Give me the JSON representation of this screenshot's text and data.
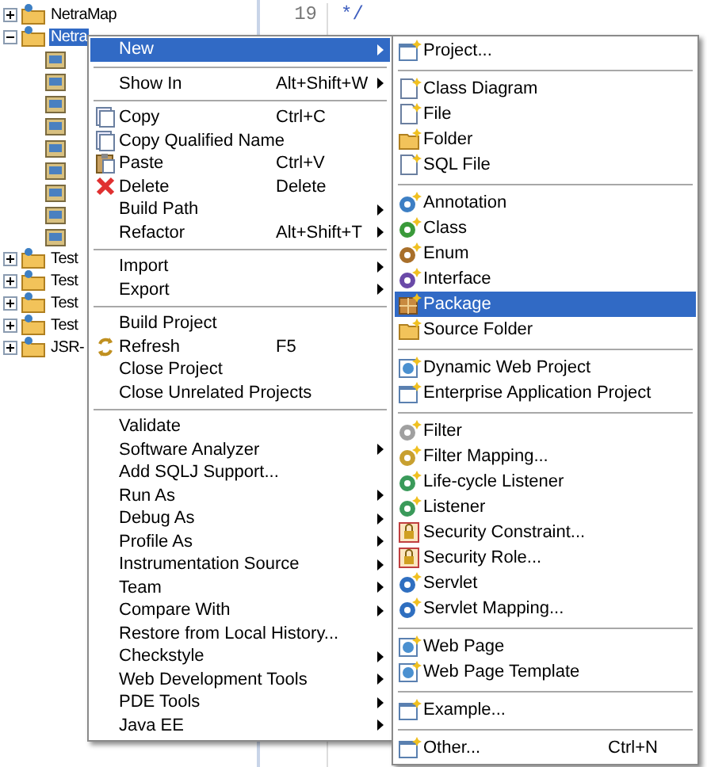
{
  "tree": {
    "items": [
      {
        "label": "NetraMap",
        "expanded": false,
        "selected": false
      },
      {
        "label": "Netra",
        "expanded": true,
        "selected": true
      },
      {
        "label": "Test",
        "expanded": false,
        "selected": false
      },
      {
        "label": "Test",
        "expanded": false,
        "selected": false
      },
      {
        "label": "Test",
        "expanded": false,
        "selected": false
      },
      {
        "label": "Test",
        "expanded": false,
        "selected": false
      },
      {
        "label": "JSR-",
        "expanded": false,
        "selected": false
      }
    ]
  },
  "editor": {
    "line_numbers": [
      "19"
    ],
    "code_lines": [
      "*/"
    ]
  },
  "context_menu": {
    "items": [
      {
        "kind": "item",
        "label": "New",
        "submenu": true,
        "selected": true
      },
      {
        "kind": "separator"
      },
      {
        "kind": "item",
        "label": "Show In",
        "shortcut": "Alt+Shift+W",
        "submenu": true,
        "selected": false
      },
      {
        "kind": "separator"
      },
      {
        "kind": "item",
        "label": "Copy",
        "shortcut": "Ctrl+C",
        "submenu": false,
        "selected": false
      },
      {
        "kind": "item",
        "label": "Copy Qualified Name",
        "submenu": false,
        "selected": false
      },
      {
        "kind": "item",
        "label": "Paste",
        "shortcut": "Ctrl+V",
        "submenu": false,
        "selected": false
      },
      {
        "kind": "item",
        "label": "Delete",
        "shortcut": "Delete",
        "submenu": false,
        "selected": false
      },
      {
        "kind": "item",
        "label": "Build Path",
        "submenu": true,
        "selected": false
      },
      {
        "kind": "item",
        "label": "Refactor",
        "shortcut": "Alt+Shift+T",
        "submenu": true,
        "selected": false
      },
      {
        "kind": "separator"
      },
      {
        "kind": "item",
        "label": "Import",
        "submenu": true,
        "selected": false
      },
      {
        "kind": "item",
        "label": "Export",
        "submenu": true,
        "selected": false
      },
      {
        "kind": "separator"
      },
      {
        "kind": "item",
        "label": "Build Project",
        "submenu": false,
        "selected": false
      },
      {
        "kind": "item",
        "label": "Refresh",
        "shortcut": "F5",
        "submenu": false,
        "selected": false
      },
      {
        "kind": "item",
        "label": "Close Project",
        "submenu": false,
        "selected": false
      },
      {
        "kind": "item",
        "label": "Close Unrelated Projects",
        "submenu": false,
        "selected": false
      },
      {
        "kind": "separator"
      },
      {
        "kind": "item",
        "label": "Validate",
        "submenu": false,
        "selected": false
      },
      {
        "kind": "item",
        "label": "Software Analyzer",
        "submenu": true,
        "selected": false
      },
      {
        "kind": "item",
        "label": "Add SQLJ Support...",
        "submenu": false,
        "selected": false
      },
      {
        "kind": "item",
        "label": "Run As",
        "submenu": true,
        "selected": false
      },
      {
        "kind": "item",
        "label": "Debug As",
        "submenu": true,
        "selected": false
      },
      {
        "kind": "item",
        "label": "Profile As",
        "submenu": true,
        "selected": false
      },
      {
        "kind": "item",
        "label": "Instrumentation Source",
        "submenu": true,
        "selected": false
      },
      {
        "kind": "item",
        "label": "Team",
        "submenu": true,
        "selected": false
      },
      {
        "kind": "item",
        "label": "Compare With",
        "submenu": true,
        "selected": false
      },
      {
        "kind": "item",
        "label": "Restore from Local History...",
        "submenu": false,
        "selected": false
      },
      {
        "kind": "item",
        "label": "Checkstyle",
        "submenu": true,
        "selected": false
      },
      {
        "kind": "item",
        "label": "Web Development Tools",
        "submenu": true,
        "selected": false
      },
      {
        "kind": "item",
        "label": "PDE Tools",
        "submenu": true,
        "selected": false
      },
      {
        "kind": "item",
        "label": "Java EE",
        "submenu": true,
        "selected": false
      }
    ]
  },
  "new_submenu": {
    "items": [
      {
        "kind": "item",
        "label": "Project...",
        "selected": false
      },
      {
        "kind": "separator"
      },
      {
        "kind": "item",
        "label": "Class Diagram",
        "selected": false
      },
      {
        "kind": "item",
        "label": "File",
        "selected": false
      },
      {
        "kind": "item",
        "label": "Folder",
        "selected": false
      },
      {
        "kind": "item",
        "label": "SQL File",
        "selected": false
      },
      {
        "kind": "separator"
      },
      {
        "kind": "item",
        "label": "Annotation",
        "selected": false
      },
      {
        "kind": "item",
        "label": "Class",
        "selected": false
      },
      {
        "kind": "item",
        "label": "Enum",
        "selected": false
      },
      {
        "kind": "item",
        "label": "Interface",
        "selected": false
      },
      {
        "kind": "item",
        "label": "Package",
        "selected": true
      },
      {
        "kind": "item",
        "label": "Source Folder",
        "selected": false
      },
      {
        "kind": "separator"
      },
      {
        "kind": "item",
        "label": "Dynamic Web Project",
        "selected": false
      },
      {
        "kind": "item",
        "label": "Enterprise Application Project",
        "selected": false
      },
      {
        "kind": "separator"
      },
      {
        "kind": "item",
        "label": "Filter",
        "selected": false
      },
      {
        "kind": "item",
        "label": "Filter Mapping...",
        "selected": false
      },
      {
        "kind": "item",
        "label": "Life-cycle Listener",
        "selected": false
      },
      {
        "kind": "item",
        "label": "Listener",
        "selected": false
      },
      {
        "kind": "item",
        "label": "Security Constraint...",
        "selected": false
      },
      {
        "kind": "item",
        "label": "Security Role...",
        "selected": false
      },
      {
        "kind": "item",
        "label": "Servlet",
        "selected": false
      },
      {
        "kind": "item",
        "label": "Servlet Mapping...",
        "selected": false
      },
      {
        "kind": "separator"
      },
      {
        "kind": "item",
        "label": "Web Page",
        "selected": false
      },
      {
        "kind": "item",
        "label": "Web Page Template",
        "selected": false
      },
      {
        "kind": "separator"
      },
      {
        "kind": "item",
        "label": "Example...",
        "selected": false
      },
      {
        "kind": "separator"
      },
      {
        "kind": "item",
        "label": "Other...",
        "shortcut": "Ctrl+N",
        "selected": false
      }
    ]
  }
}
